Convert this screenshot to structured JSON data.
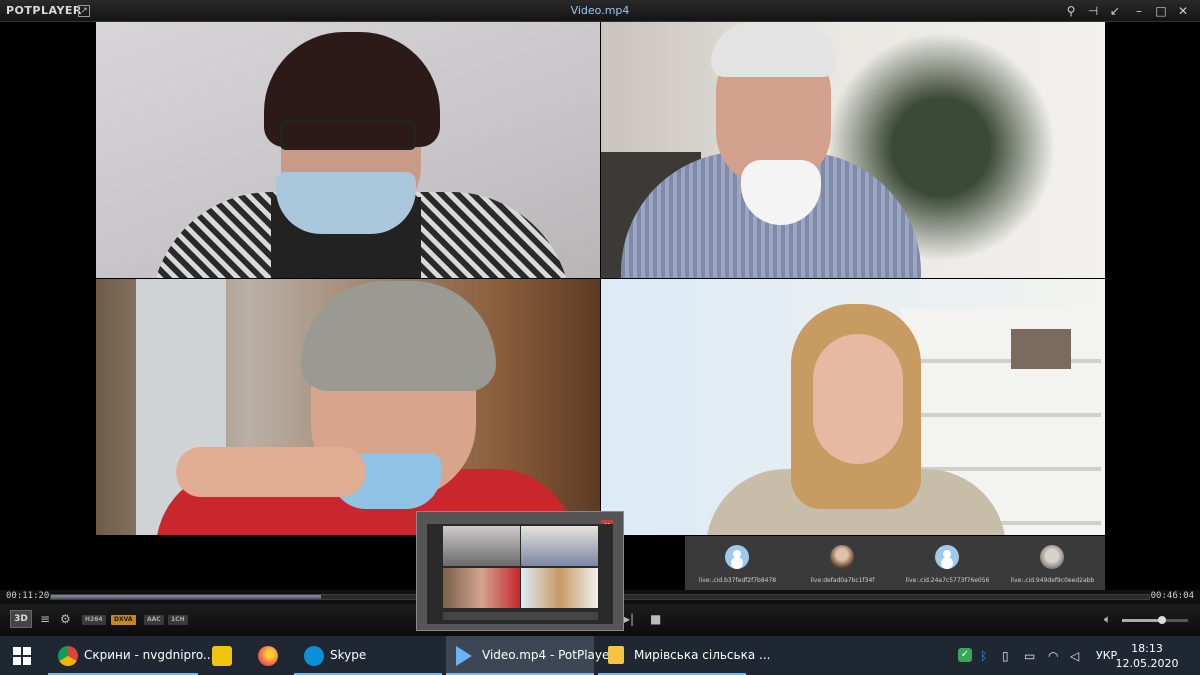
{
  "titlebar": {
    "brand": "POTPLAYER",
    "title": "Video.mp4"
  },
  "participants": [
    "live:.cid.b37fedf2f7b8478",
    "live:defad0a7bc1f34f",
    "live:.cid.24a7c5773f76e056",
    "live:.cid.949def9c0eed2abb"
  ],
  "player": {
    "time_current": "00:11:20",
    "time_total": "00:46:04",
    "progress": 0.246,
    "volume": 0.6,
    "badges": [
      "H264",
      "DXVA",
      "AAC",
      "1CH"
    ]
  },
  "taskbar": {
    "items": [
      {
        "label": "Скрини - nvgdnipro...",
        "icon": "chrome-icon"
      },
      {
        "label": "",
        "icon": "archive-icon"
      },
      {
        "label": "",
        "icon": "firefox-icon"
      },
      {
        "label": "Skype",
        "icon": "skype-icon"
      },
      {
        "label": "Video.mp4 - PotPlayer",
        "icon": "potplayer-icon"
      },
      {
        "label": "Мирівська сільська ...",
        "icon": "folder-icon"
      }
    ],
    "lang": "УКР",
    "time": "18:13",
    "date": "12.05.2020"
  },
  "colors": {
    "accent": "#76b9ed",
    "taskbar": "#1f2733",
    "close": "#d23a3a"
  }
}
